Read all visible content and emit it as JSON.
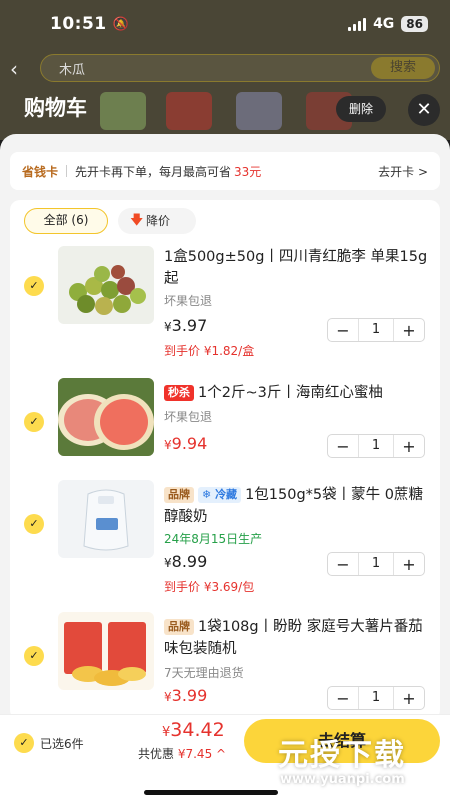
{
  "status_bar": {
    "time": "10:51",
    "network": "4G",
    "battery": "86"
  },
  "background": {
    "search_text": "木瓜",
    "search_button": "搜索"
  },
  "sheet": {
    "title": "购物车",
    "delete_label": "删除"
  },
  "saving_card": {
    "name": "省钱卡",
    "desc": "先开卡再下单，每月最高可省",
    "amount": "33元",
    "action": "去开卡 >"
  },
  "filters": {
    "all": "全部 (6)",
    "price_drop": "降价"
  },
  "items": [
    {
      "title": "1盒500g±50g丨四川青红脆李 单果15g起",
      "sub": "坏果包退",
      "price_symbol": "¥",
      "price": "3.97",
      "final_price": "到手价 ¥1.82/盒",
      "qty": "1"
    },
    {
      "tag": "秒杀",
      "title": "1个2斤~3斤丨海南红心蜜柚",
      "sub": "坏果包退",
      "price_symbol": "¥",
      "price": "9.94",
      "qty": "1"
    },
    {
      "tag_brand": "品牌",
      "tag_cold": "冷藏",
      "title": "1包150g*5袋丨蒙牛 0蔗糖醇酸奶",
      "sub": "24年8月15日生产",
      "price_symbol": "¥",
      "price": "8.99",
      "final_price": "到手价 ¥3.69/包",
      "qty": "1"
    },
    {
      "tag_brand": "品牌",
      "title": "1袋108g丨盼盼 家庭号大薯片番茄味包装随机",
      "sub": "7天无理由退货",
      "price_symbol": "¥",
      "price": "3.99",
      "qty": "1"
    }
  ],
  "bottom_bar": {
    "selected": "已选6件",
    "total_symbol": "¥",
    "total": "34.42",
    "saved_label": "共优惠",
    "saved_amount": "¥7.45",
    "pay_label": "去结算"
  },
  "watermark": {
    "big": "元授下载",
    "small": "www.yuanpi.com"
  },
  "colors": {
    "accent": "#fcd53a",
    "price_red": "#e5322d",
    "brand_text": "#b86a1e"
  }
}
